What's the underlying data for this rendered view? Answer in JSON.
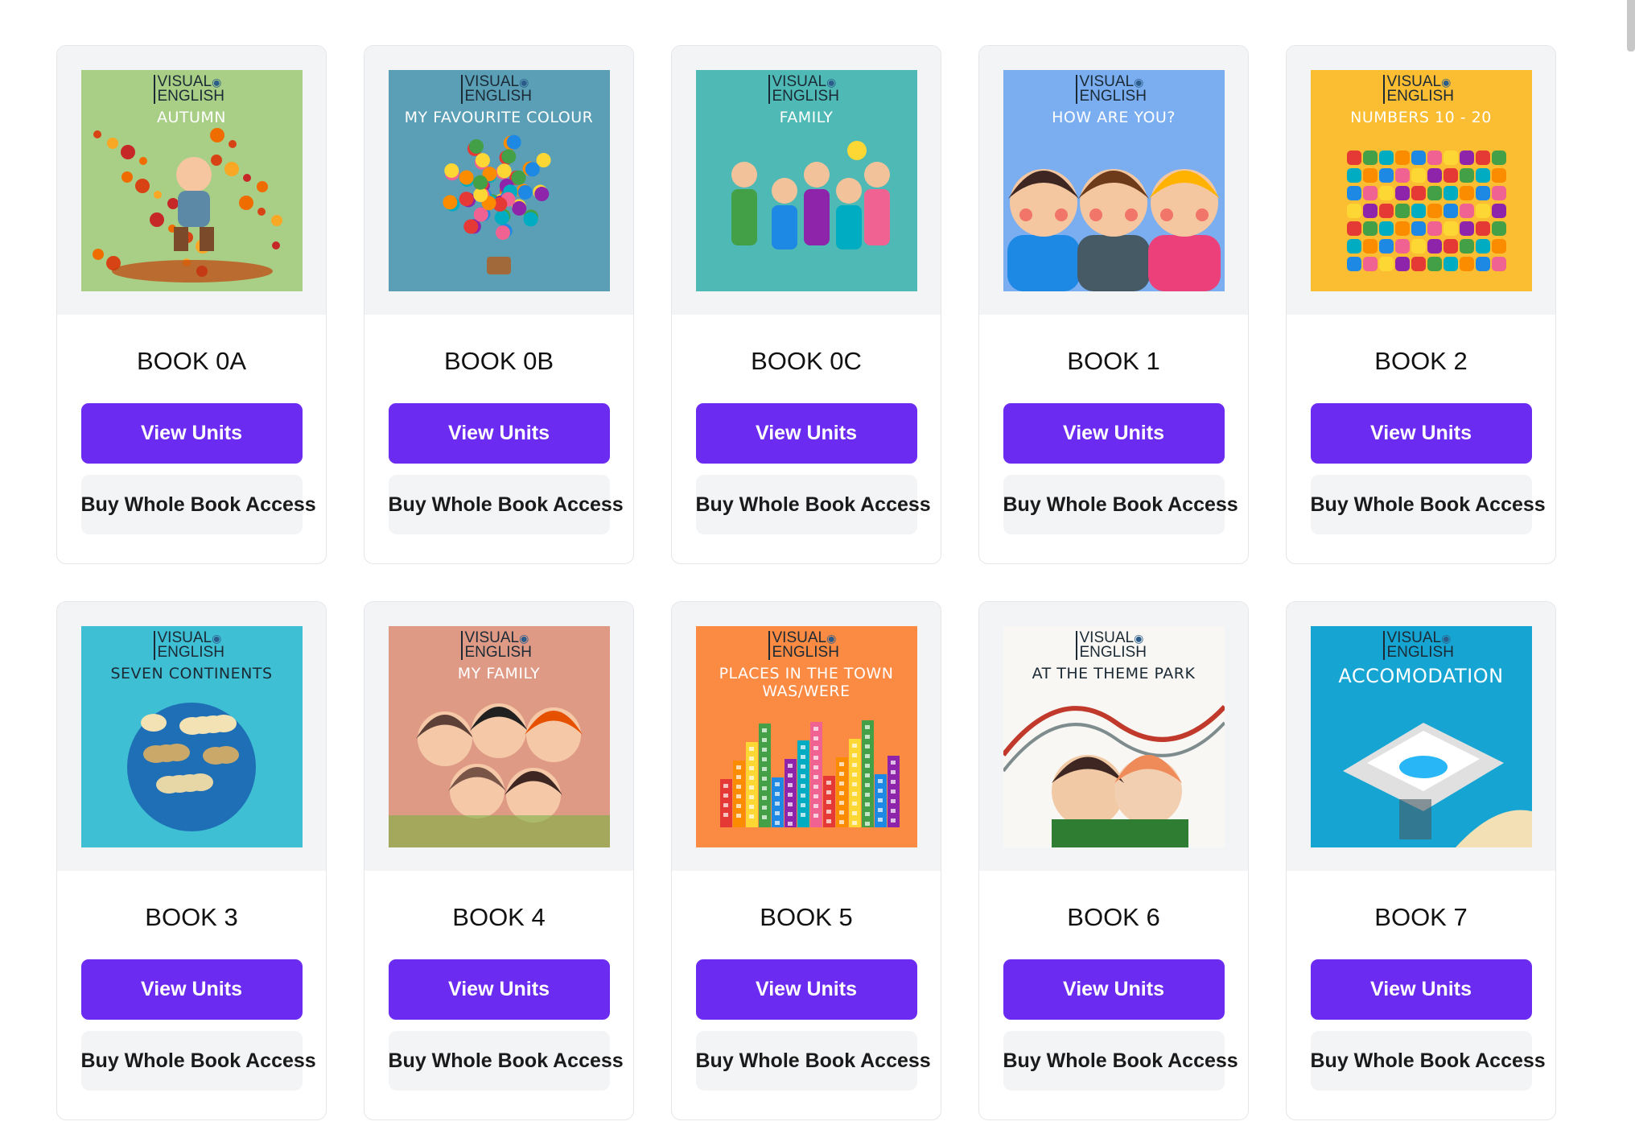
{
  "brand": {
    "line1": "VISUAL",
    "line2": "ENGLISH"
  },
  "actions": {
    "view_label": "View Units",
    "buy_label": "Buy Whole Book Access"
  },
  "books": [
    {
      "title": "BOOK 0A",
      "cover_title": "AUTUMN",
      "bg": "#a9cf86",
      "title_color": "#ffffff",
      "theme": "autumn"
    },
    {
      "title": "BOOK 0B",
      "cover_title": "MY FAVOURITE COLOUR",
      "bg": "#5a9fb6",
      "title_color": "#ffffff",
      "theme": "balloon"
    },
    {
      "title": "BOOK 0C",
      "cover_title": "FAMILY",
      "bg": "#4fb9b5",
      "title_color": "#ffffff",
      "theme": "family"
    },
    {
      "title": "BOOK 1",
      "cover_title": "HOW ARE YOU?",
      "bg": "#7aaef0",
      "title_color": "#ffffff",
      "theme": "faces"
    },
    {
      "title": "BOOK 2",
      "cover_title": "NUMBERS 10 - 20",
      "bg": "#fbbd32",
      "title_color": "#ffffff",
      "theme": "numbers"
    },
    {
      "title": "BOOK 3",
      "cover_title": "SEVEN CONTINENTS",
      "bg": "#3fbfd3",
      "title_color": "#1b2a35",
      "theme": "globe"
    },
    {
      "title": "BOOK 4",
      "cover_title": "MY FAMILY",
      "bg": "#df9a86",
      "title_color": "#ffffff",
      "theme": "myfamily"
    },
    {
      "title": "BOOK 5",
      "cover_title": "PLACES IN THE TOWN WAS/WERE",
      "bg": "#fb8a43",
      "title_color": "#ffffff",
      "theme": "town"
    },
    {
      "title": "BOOK 6",
      "cover_title": "AT THE THEME PARK",
      "bg": "#f8f7f3",
      "title_color": "#1b2a35",
      "theme": "park"
    },
    {
      "title": "BOOK 7",
      "cover_title": "ACCOMODATION",
      "bg": "#16a5d2",
      "title_color": "#ffffff",
      "theme": "hotel"
    }
  ]
}
